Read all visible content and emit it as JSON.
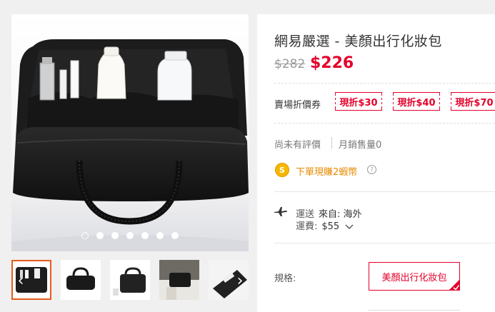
{
  "gallery": {
    "dot_count": 7,
    "active_dot": 0,
    "prev_label": "‹",
    "next_label": "›"
  },
  "product": {
    "title": "網易嚴選 - 美顏出行化妝包",
    "original_price": "$282",
    "sale_price": "$226"
  },
  "coupons": {
    "label": "賣場折價券",
    "items": [
      "現折$30",
      "現折$40",
      "現折$70"
    ]
  },
  "stats": {
    "rating": "尚未有評價",
    "sales": "月銷售量0"
  },
  "reward": {
    "coin_glyph": "S",
    "text": "下單現賺2蝦幣",
    "info_glyph": "?"
  },
  "shipping": {
    "row1_key": "運送",
    "row1_value": "來自: 海外",
    "row2_key": "運費:",
    "row2_value": "$55"
  },
  "spec": {
    "label": "規格:",
    "selected_option": "美顏出行化妝包"
  },
  "colors": {
    "accent": "#e4002b",
    "coin": "#f5b800",
    "reward_text": "#e98900",
    "thumb_selected_border": "#e85a1c"
  }
}
